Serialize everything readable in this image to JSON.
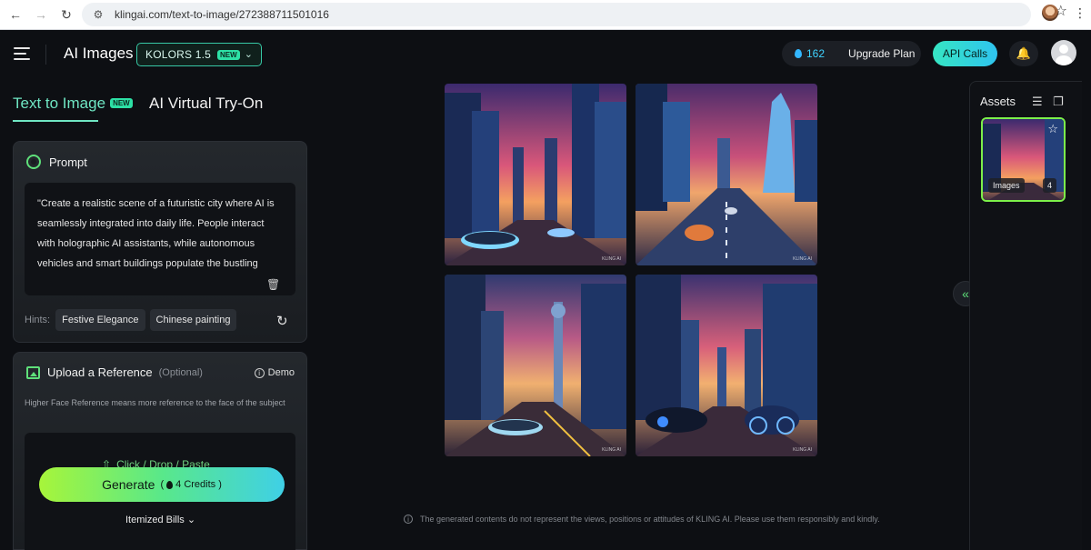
{
  "browser": {
    "url": "klingai.com/text-to-image/272388711501016"
  },
  "header": {
    "title": "AI Images",
    "model": {
      "label": "KOLORS 1.5",
      "badge": "NEW"
    },
    "credits": "162",
    "upgrade_label": "Upgrade Plan",
    "api_label": "API Calls"
  },
  "tabs": {
    "text_to_image": "Text to Image",
    "text_to_image_badge": "NEW",
    "virtual_tryon": "AI Virtual Try-On"
  },
  "prompt": {
    "title": "Prompt",
    "text": "\"Create a realistic scene of a futuristic city where AI is seamlessly integrated into daily life. People interact with holographic AI assistants, while autonomous vehicles and smart buildings populate the bustling",
    "hints_label": "Hints:",
    "hints": [
      "Festive Elegance",
      "Chinese painting"
    ]
  },
  "reference": {
    "title": "Upload a Reference",
    "optional": "(Optional)",
    "demo": "Demo",
    "description": "Higher Face Reference means more reference to the face of the subject",
    "drop_text": "Click / Drop / Paste"
  },
  "generate": {
    "label": "Generate",
    "credits": "4 Credits"
  },
  "itemized_label": "Itemized Bills",
  "disclaimer": "The generated contents do not represent the views, positions or attitudes of KLING AI. Please use them responsibly and kindly.",
  "watermark": "KLING AI",
  "assets": {
    "title": "Assets",
    "label": "Images",
    "count": "4"
  },
  "colors": {
    "accent": "#6fe6c3",
    "accent_green": "#5fe07a",
    "background": "#0d0f13"
  }
}
